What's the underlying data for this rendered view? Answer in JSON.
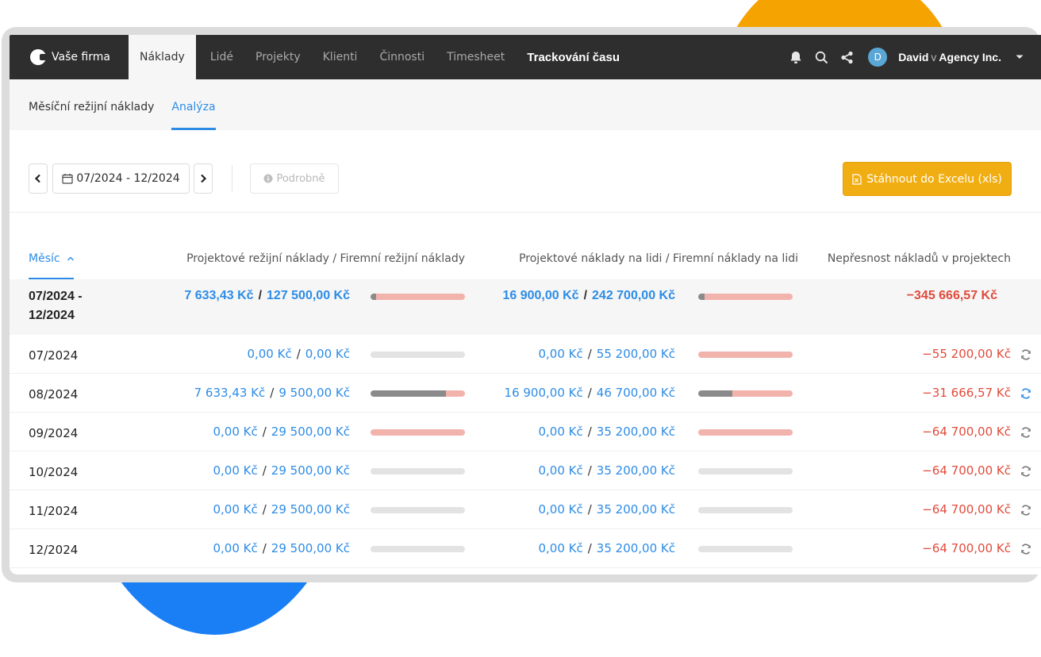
{
  "nav": {
    "brand": "Vaše firma",
    "items": [
      {
        "label": "Náklady",
        "active": true
      },
      {
        "label": "Lidé"
      },
      {
        "label": "Projekty"
      },
      {
        "label": "Klienti"
      },
      {
        "label": "Činnosti"
      },
      {
        "label": "Timesheet"
      },
      {
        "label": "Trackování času",
        "bold": true
      }
    ],
    "user_initial": "D",
    "user_name": "David",
    "user_sep": "v",
    "org": "Agency Inc."
  },
  "subnav": {
    "tabs": [
      {
        "label": "Měsíční režijní náklady"
      },
      {
        "label": "Analýza",
        "active": true
      }
    ]
  },
  "toolbar": {
    "date_range": "07/2024 - 12/2024",
    "detail_label": "Podrobně",
    "excel_label": "Stáhnout do Excelu (xls)"
  },
  "table": {
    "columns": {
      "month": "Měsíc",
      "overhead": "Projektové režijní náklady / Firemní režijní náklady",
      "people": "Projektové náklady na lidi / Firemní náklady na lidi",
      "diff": "Nepřesnost nákladů v projektech"
    },
    "total": {
      "month": "07/2024 - 12/2024",
      "overhead_project": "7 633,43 Kč",
      "overhead_company": "127 500,00 Kč",
      "people_project": "16 900,00 Kč",
      "people_company": "242 700,00 Kč",
      "diff": "−345 666,57 Kč",
      "overhead_ratio": 0.06,
      "people_ratio": 0.07
    },
    "rows": [
      {
        "month": "07/2024",
        "overhead_project": "0,00 Kč",
        "overhead_company": "0,00 Kč",
        "people_project": "0,00 Kč",
        "people_company": "55 200,00 Kč",
        "diff": "−55 200,00 Kč"
      },
      {
        "month": "08/2024",
        "overhead_project": "7 633,43 Kč",
        "overhead_company": "9 500,00 Kč",
        "people_project": "16 900,00 Kč",
        "people_company": "46 700,00 Kč",
        "diff": "−31 666,57 Kč"
      },
      {
        "month": "09/2024",
        "overhead_project": "0,00 Kč",
        "overhead_company": "29 500,00 Kč",
        "people_project": "0,00 Kč",
        "people_company": "35 200,00 Kč",
        "diff": "−64 700,00 Kč"
      },
      {
        "month": "10/2024",
        "overhead_project": "0,00 Kč",
        "overhead_company": "29 500,00 Kč",
        "people_project": "0,00 Kč",
        "people_company": "35 200,00 Kč",
        "diff": "−64 700,00 Kč"
      },
      {
        "month": "11/2024",
        "overhead_project": "0,00 Kč",
        "overhead_company": "29 500,00 Kč",
        "people_project": "0,00 Kč",
        "people_company": "35 200,00 Kč",
        "diff": "−64 700,00 Kč"
      },
      {
        "month": "12/2024",
        "overhead_project": "0,00 Kč",
        "overhead_company": "29 500,00 Kč",
        "people_project": "0,00 Kč",
        "people_company": "35 200,00 Kč",
        "diff": "−64 700,00 Kč"
      }
    ],
    "row_bars": [
      {
        "overhead": null,
        "people": 0.0
      },
      {
        "overhead": 0.8,
        "people": 0.36
      },
      {
        "overhead": 0.0,
        "people": 0.0
      },
      {
        "overhead": null,
        "people": null
      },
      {
        "overhead": null,
        "people": null
      },
      {
        "overhead": null,
        "people": null
      }
    ]
  },
  "colors": {
    "accent_blue": "#2d8ce6",
    "negative_red": "#e24a3b",
    "excel_yellow": "#f0ae12",
    "nav_dark": "#2e2e2e"
  }
}
